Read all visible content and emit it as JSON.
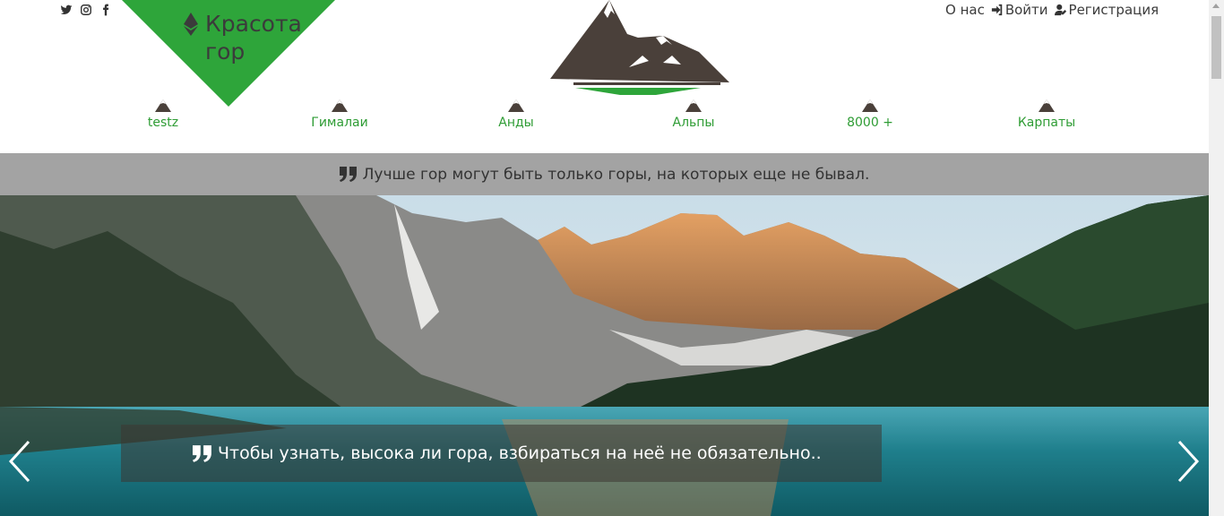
{
  "brand": {
    "title_line1": "Красота",
    "title_line2": "гор"
  },
  "social": [
    "twitter-icon",
    "instagram-icon",
    "facebook-icon"
  ],
  "topnav": {
    "about": "О нас",
    "login": "Войти",
    "register": "Регистрация"
  },
  "categories": [
    "testz",
    "Гималаи",
    "Анды",
    "Альпы",
    "8000 +",
    "Карпаты"
  ],
  "quote_bar": {
    "text": "Лучше гор могут быть только горы, на которых еще не бывал."
  },
  "hero": {
    "caption": "Чтобы узнать, высока ли гора, взбираться на неё не обязательно.."
  },
  "colors": {
    "accent": "#2e9c34",
    "dark": "#4a403a",
    "quote_bg": "#a3a3a3"
  }
}
